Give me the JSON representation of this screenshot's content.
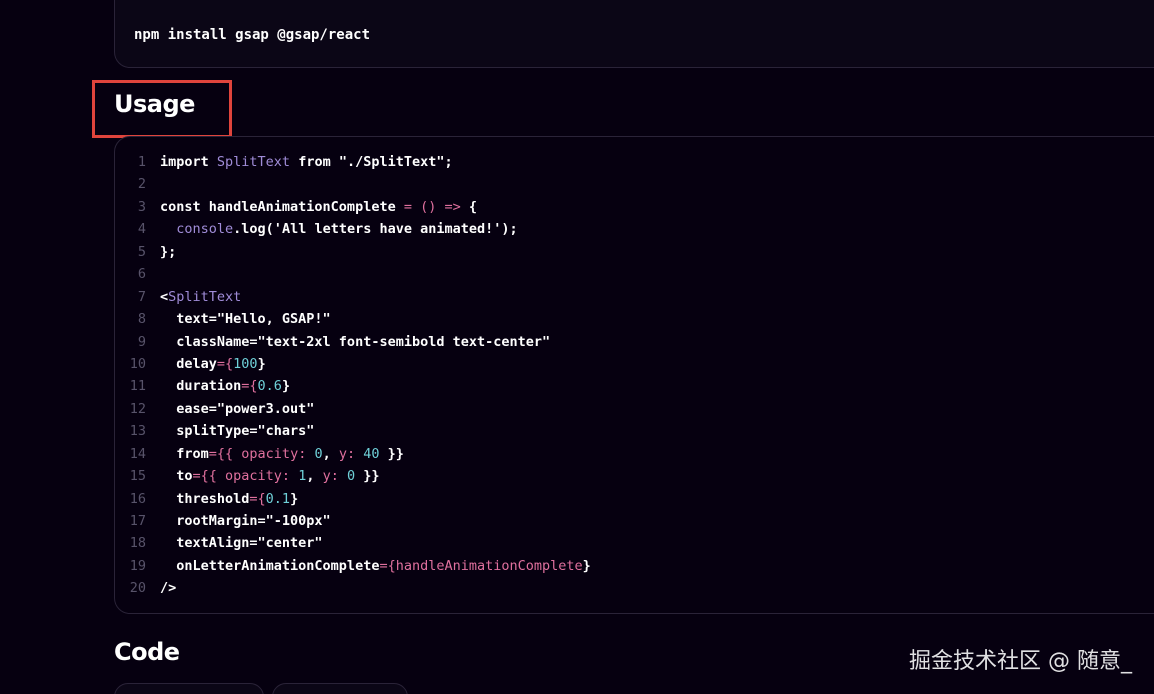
{
  "install": {
    "command": "npm install gsap @gsap/react"
  },
  "usage": {
    "heading": "Usage"
  },
  "code_block": {
    "lines": [
      {
        "n": "1",
        "tokens": [
          {
            "t": "import ",
            "k": "plain"
          },
          {
            "t": "SplitText",
            "k": "comp"
          },
          {
            "t": " from ",
            "k": "plain"
          },
          {
            "t": "\"./SplitText\";",
            "k": "str"
          }
        ]
      },
      {
        "n": "2",
        "tokens": []
      },
      {
        "n": "3",
        "tokens": [
          {
            "t": "const handleAnimationComplete ",
            "k": "plain"
          },
          {
            "t": "= () =>",
            "k": "op"
          },
          {
            "t": " {",
            "k": "punc"
          }
        ]
      },
      {
        "n": "4",
        "tokens": [
          {
            "t": "  ",
            "k": "plain"
          },
          {
            "t": "console",
            "k": "obj"
          },
          {
            "t": ".log('All letters have animated!');",
            "k": "fn"
          }
        ]
      },
      {
        "n": "5",
        "tokens": [
          {
            "t": "};",
            "k": "punc"
          }
        ]
      },
      {
        "n": "6",
        "tokens": []
      },
      {
        "n": "7",
        "tokens": [
          {
            "t": "<",
            "k": "punc"
          },
          {
            "t": "SplitText",
            "k": "comp"
          }
        ]
      },
      {
        "n": "8",
        "tokens": [
          {
            "t": "  text=\"Hello, GSAP!\"",
            "k": "plain"
          }
        ]
      },
      {
        "n": "9",
        "tokens": [
          {
            "t": "  className=\"text-2xl font-semibold text-center\"",
            "k": "plain"
          }
        ]
      },
      {
        "n": "10",
        "tokens": [
          {
            "t": "  delay",
            "k": "plain"
          },
          {
            "t": "={",
            "k": "op"
          },
          {
            "t": "100",
            "k": "num"
          },
          {
            "t": "}",
            "k": "punc"
          }
        ]
      },
      {
        "n": "11",
        "tokens": [
          {
            "t": "  duration",
            "k": "plain"
          },
          {
            "t": "={",
            "k": "op"
          },
          {
            "t": "0.6",
            "k": "num"
          },
          {
            "t": "}",
            "k": "punc"
          }
        ]
      },
      {
        "n": "12",
        "tokens": [
          {
            "t": "  ease=\"power3.out\"",
            "k": "plain"
          }
        ]
      },
      {
        "n": "13",
        "tokens": [
          {
            "t": "  splitType=\"chars\"",
            "k": "plain"
          }
        ]
      },
      {
        "n": "14",
        "tokens": [
          {
            "t": "  from",
            "k": "plain"
          },
          {
            "t": "={{ ",
            "k": "op"
          },
          {
            "t": "opacity: ",
            "k": "key"
          },
          {
            "t": "0",
            "k": "num"
          },
          {
            "t": ", ",
            "k": "punc"
          },
          {
            "t": "y: ",
            "k": "key"
          },
          {
            "t": "40",
            "k": "num"
          },
          {
            "t": " }}",
            "k": "punc"
          }
        ]
      },
      {
        "n": "15",
        "tokens": [
          {
            "t": "  to",
            "k": "plain"
          },
          {
            "t": "={{ ",
            "k": "op"
          },
          {
            "t": "opacity: ",
            "k": "key"
          },
          {
            "t": "1",
            "k": "num"
          },
          {
            "t": ", ",
            "k": "punc"
          },
          {
            "t": "y: ",
            "k": "key"
          },
          {
            "t": "0",
            "k": "num"
          },
          {
            "t": " }}",
            "k": "punc"
          }
        ]
      },
      {
        "n": "16",
        "tokens": [
          {
            "t": "  threshold",
            "k": "plain"
          },
          {
            "t": "={",
            "k": "op"
          },
          {
            "t": "0.1",
            "k": "num"
          },
          {
            "t": "}",
            "k": "punc"
          }
        ]
      },
      {
        "n": "17",
        "tokens": [
          {
            "t": "  rootMargin=\"-100px\"",
            "k": "plain"
          }
        ]
      },
      {
        "n": "18",
        "tokens": [
          {
            "t": "  textAlign=\"center\"",
            "k": "plain"
          }
        ]
      },
      {
        "n": "19",
        "tokens": [
          {
            "t": "  onLetterAnimationComplete",
            "k": "plain"
          },
          {
            "t": "={",
            "k": "op"
          },
          {
            "t": "handleAnimationComplete",
            "k": "ref"
          },
          {
            "t": "}",
            "k": "punc"
          }
        ]
      },
      {
        "n": "20",
        "tokens": [
          {
            "t": "/>",
            "k": "punc"
          }
        ]
      }
    ]
  },
  "code_section": {
    "heading": "Code"
  },
  "watermark": {
    "text": "掘金技术社区 @ 随意_"
  },
  "colors": {
    "background": "#060010",
    "border": "#2a2338",
    "highlight": "#e0443c",
    "component": "#a08cd8",
    "operator": "#e0709e",
    "number": "#6fd0d8"
  }
}
